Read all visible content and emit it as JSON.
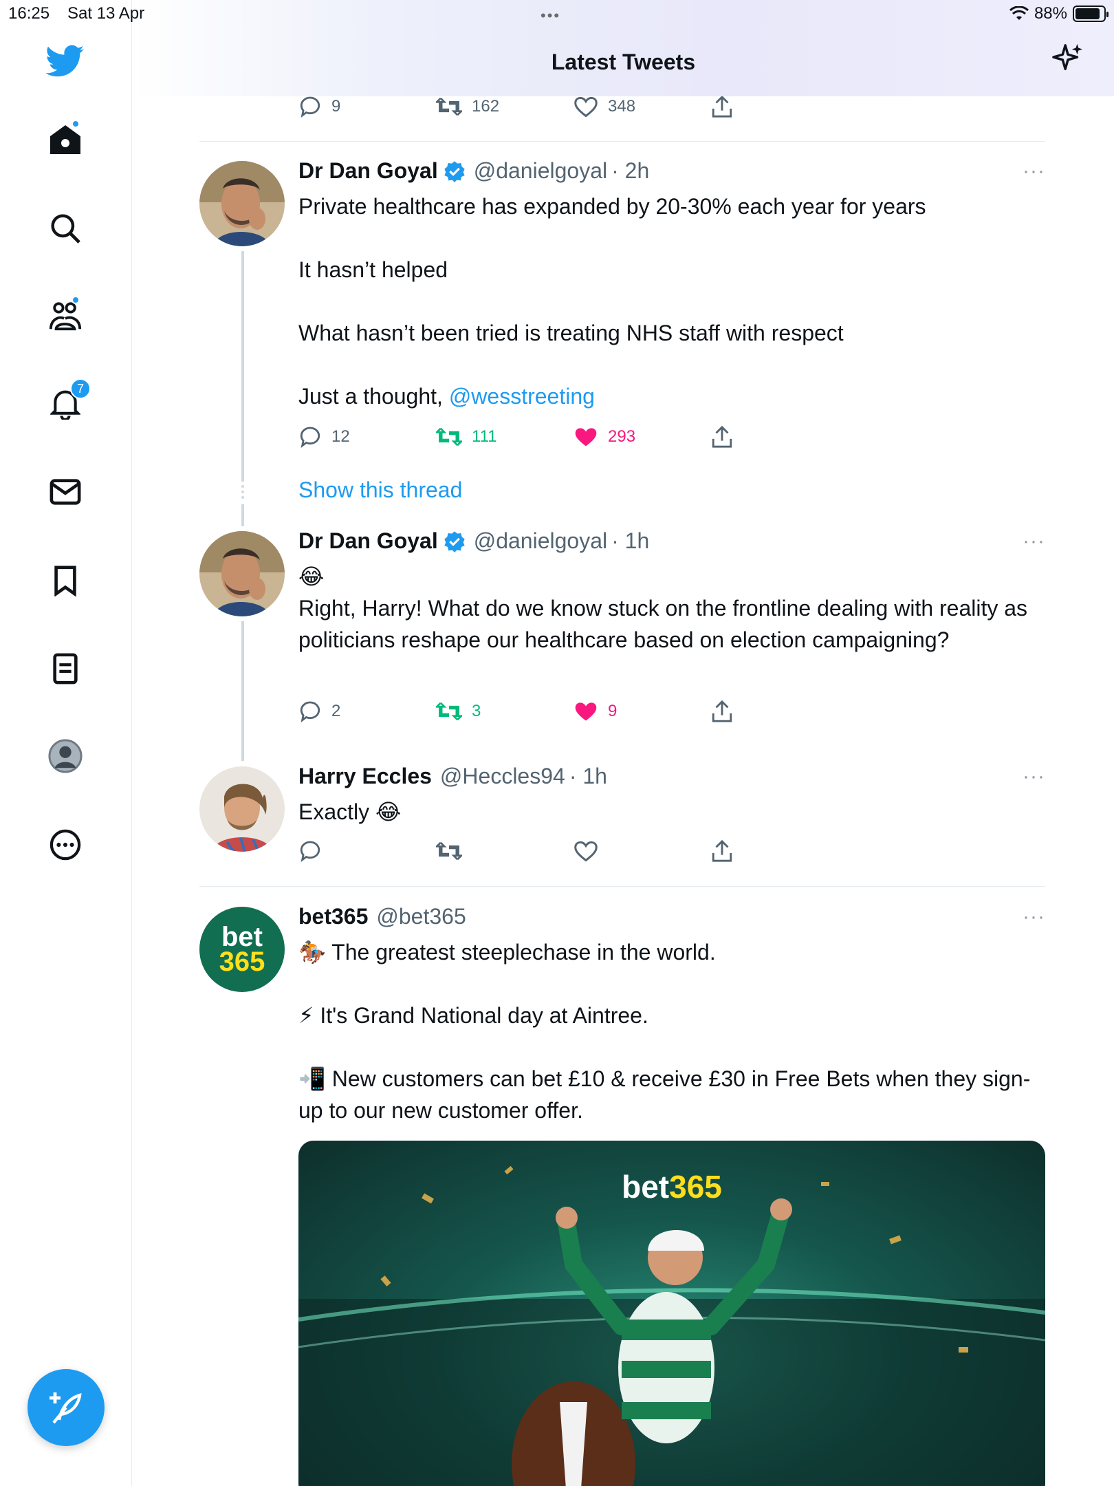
{
  "status_bar": {
    "time": "16:25",
    "date": "Sat 13 Apr",
    "battery": "88%",
    "battery_level": 0.88
  },
  "header": {
    "title": "Latest Tweets"
  },
  "sidebar": {
    "items": [
      "home-icon",
      "search-icon",
      "communities-icon",
      "notifications-icon",
      "messages-icon",
      "bookmarks-icon",
      "lists-icon",
      "profile-icon",
      "more-icon"
    ],
    "notifications_count": "7"
  },
  "prev_tweet_actions": {
    "replies": "9",
    "retweets": "162",
    "likes": "348"
  },
  "tweets": [
    {
      "name": "Dr Dan Goyal",
      "handle": "@danielgoyal",
      "time": "· 2h",
      "lines": [
        "Private healthcare has expanded by 20-30% each year for years",
        "It hasn’t helped",
        "What hasn’t been tried is treating NHS staff with respect",
        "Just a thought, "
      ],
      "mention": "@wesstreeting",
      "replies": "12",
      "retweets": "111",
      "likes": "293"
    },
    {
      "name": "Dr Dan Goyal",
      "handle": "@danielgoyal",
      "time": "· 1h",
      "emoji": "😂",
      "body": "Right, Harry! What do we know stuck on the frontline dealing with reality as politicians reshape our healthcare based on election campaigning?",
      "replies": "2",
      "retweets": "3",
      "likes": "9"
    },
    {
      "name": "Harry Eccles",
      "handle": "@Heccles94",
      "time": "· 1h",
      "body": "Exactly 😂"
    },
    {
      "name": "bet365",
      "handle": "@bet365",
      "line1": "🏇 The greatest steeplechase in the world.",
      "line2": "⚡ It's Grand National day at Aintree.",
      "line3": "📲 New customers can bet £10 & receive £30 in Free Bets when they sign-up to our new customer offer.",
      "avatar_text_1": "bet",
      "avatar_text_2": "365",
      "image_logo_1": "bet",
      "image_logo_2": "365"
    }
  ],
  "show_thread": "Show this thread",
  "more_dots": "···",
  "colors": {
    "accent": "#1d9bf0",
    "retweet": "#00ba7c",
    "like": "#f91880",
    "bet365_green": "#126e51",
    "bet365_yellow": "#ffdf1b"
  }
}
